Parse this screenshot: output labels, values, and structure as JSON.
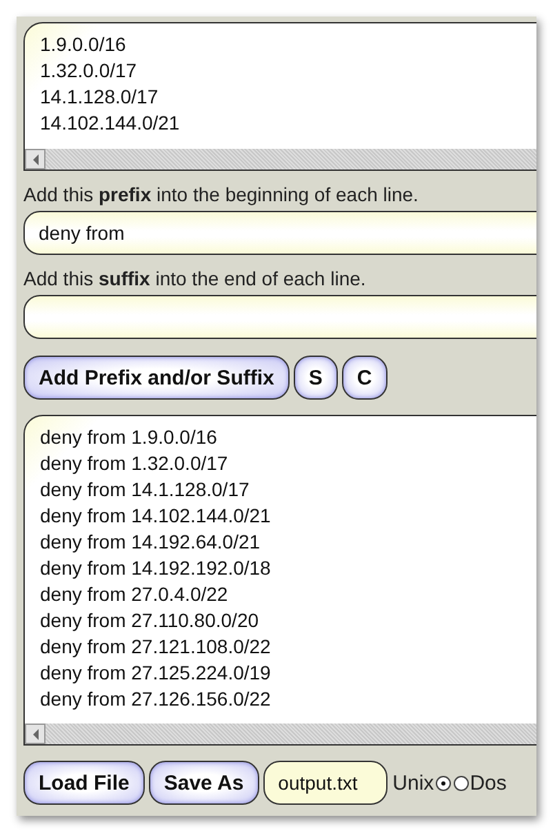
{
  "input_lines": [
    "1.9.0.0/16",
    "1.32.0.0/17",
    "14.1.128.0/17",
    "14.102.144.0/21"
  ],
  "prefix_label": "Add this **prefix** into the beginning of each line.",
  "prefix_field": {
    "value": "deny from"
  },
  "suffix_label": "Add this **suffix** into the end of each line.",
  "action_buttons": [
    "Add Prefix and/or Suffix",
    "S",
    "C"
  ],
  "output_lines": [
    "deny from 1.9.0.0/16",
    "deny from 1.32.0.0/17",
    "deny from 14.1.128.0/17",
    "deny from 14.102.144.0/21",
    "deny from 14.192.64.0/21",
    "deny from 14.192.192.0/18",
    "deny from 27.0.4.0/22",
    "deny from 27.110.80.0/20",
    "deny from 27.121.108.0/22",
    "deny from 27.125.224.0/19",
    "deny from 27.126.156.0/22"
  ],
  "file_buttons": [
    "Load File",
    "Save As"
  ],
  "filename_field": {
    "value": "output.txt"
  },
  "line_endings": [
    {
      "label": "Unix",
      "selected": true
    },
    {
      "label": "Dos",
      "selected": false
    }
  ]
}
